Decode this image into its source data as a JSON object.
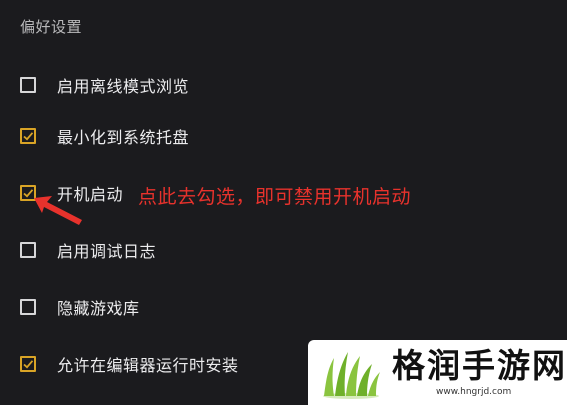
{
  "section": {
    "title": "偏好设置"
  },
  "preferences": [
    {
      "label": "启用离线模式浏览",
      "checked": false
    },
    {
      "label": "最小化到系统托盘",
      "checked": true
    },
    {
      "label": "开机启动",
      "checked": true
    },
    {
      "label": "启用调试日志",
      "checked": false
    },
    {
      "label": "隐藏游戏库",
      "checked": false
    },
    {
      "label": "允许在编辑器运行时安装",
      "checked": true
    }
  ],
  "annotation": {
    "text": "点此去勾选，即可禁用开机启动",
    "color": "#e8322c"
  },
  "watermark": {
    "name": "格润手游网",
    "url": "www.hngrjd.com"
  },
  "colors": {
    "background": "#1b1b1e",
    "checkbox_checked": "#d9a426",
    "checkbox_unchecked": "#d6d6d8",
    "label_text": "#ececee",
    "logo_green": "#8ac43f"
  }
}
